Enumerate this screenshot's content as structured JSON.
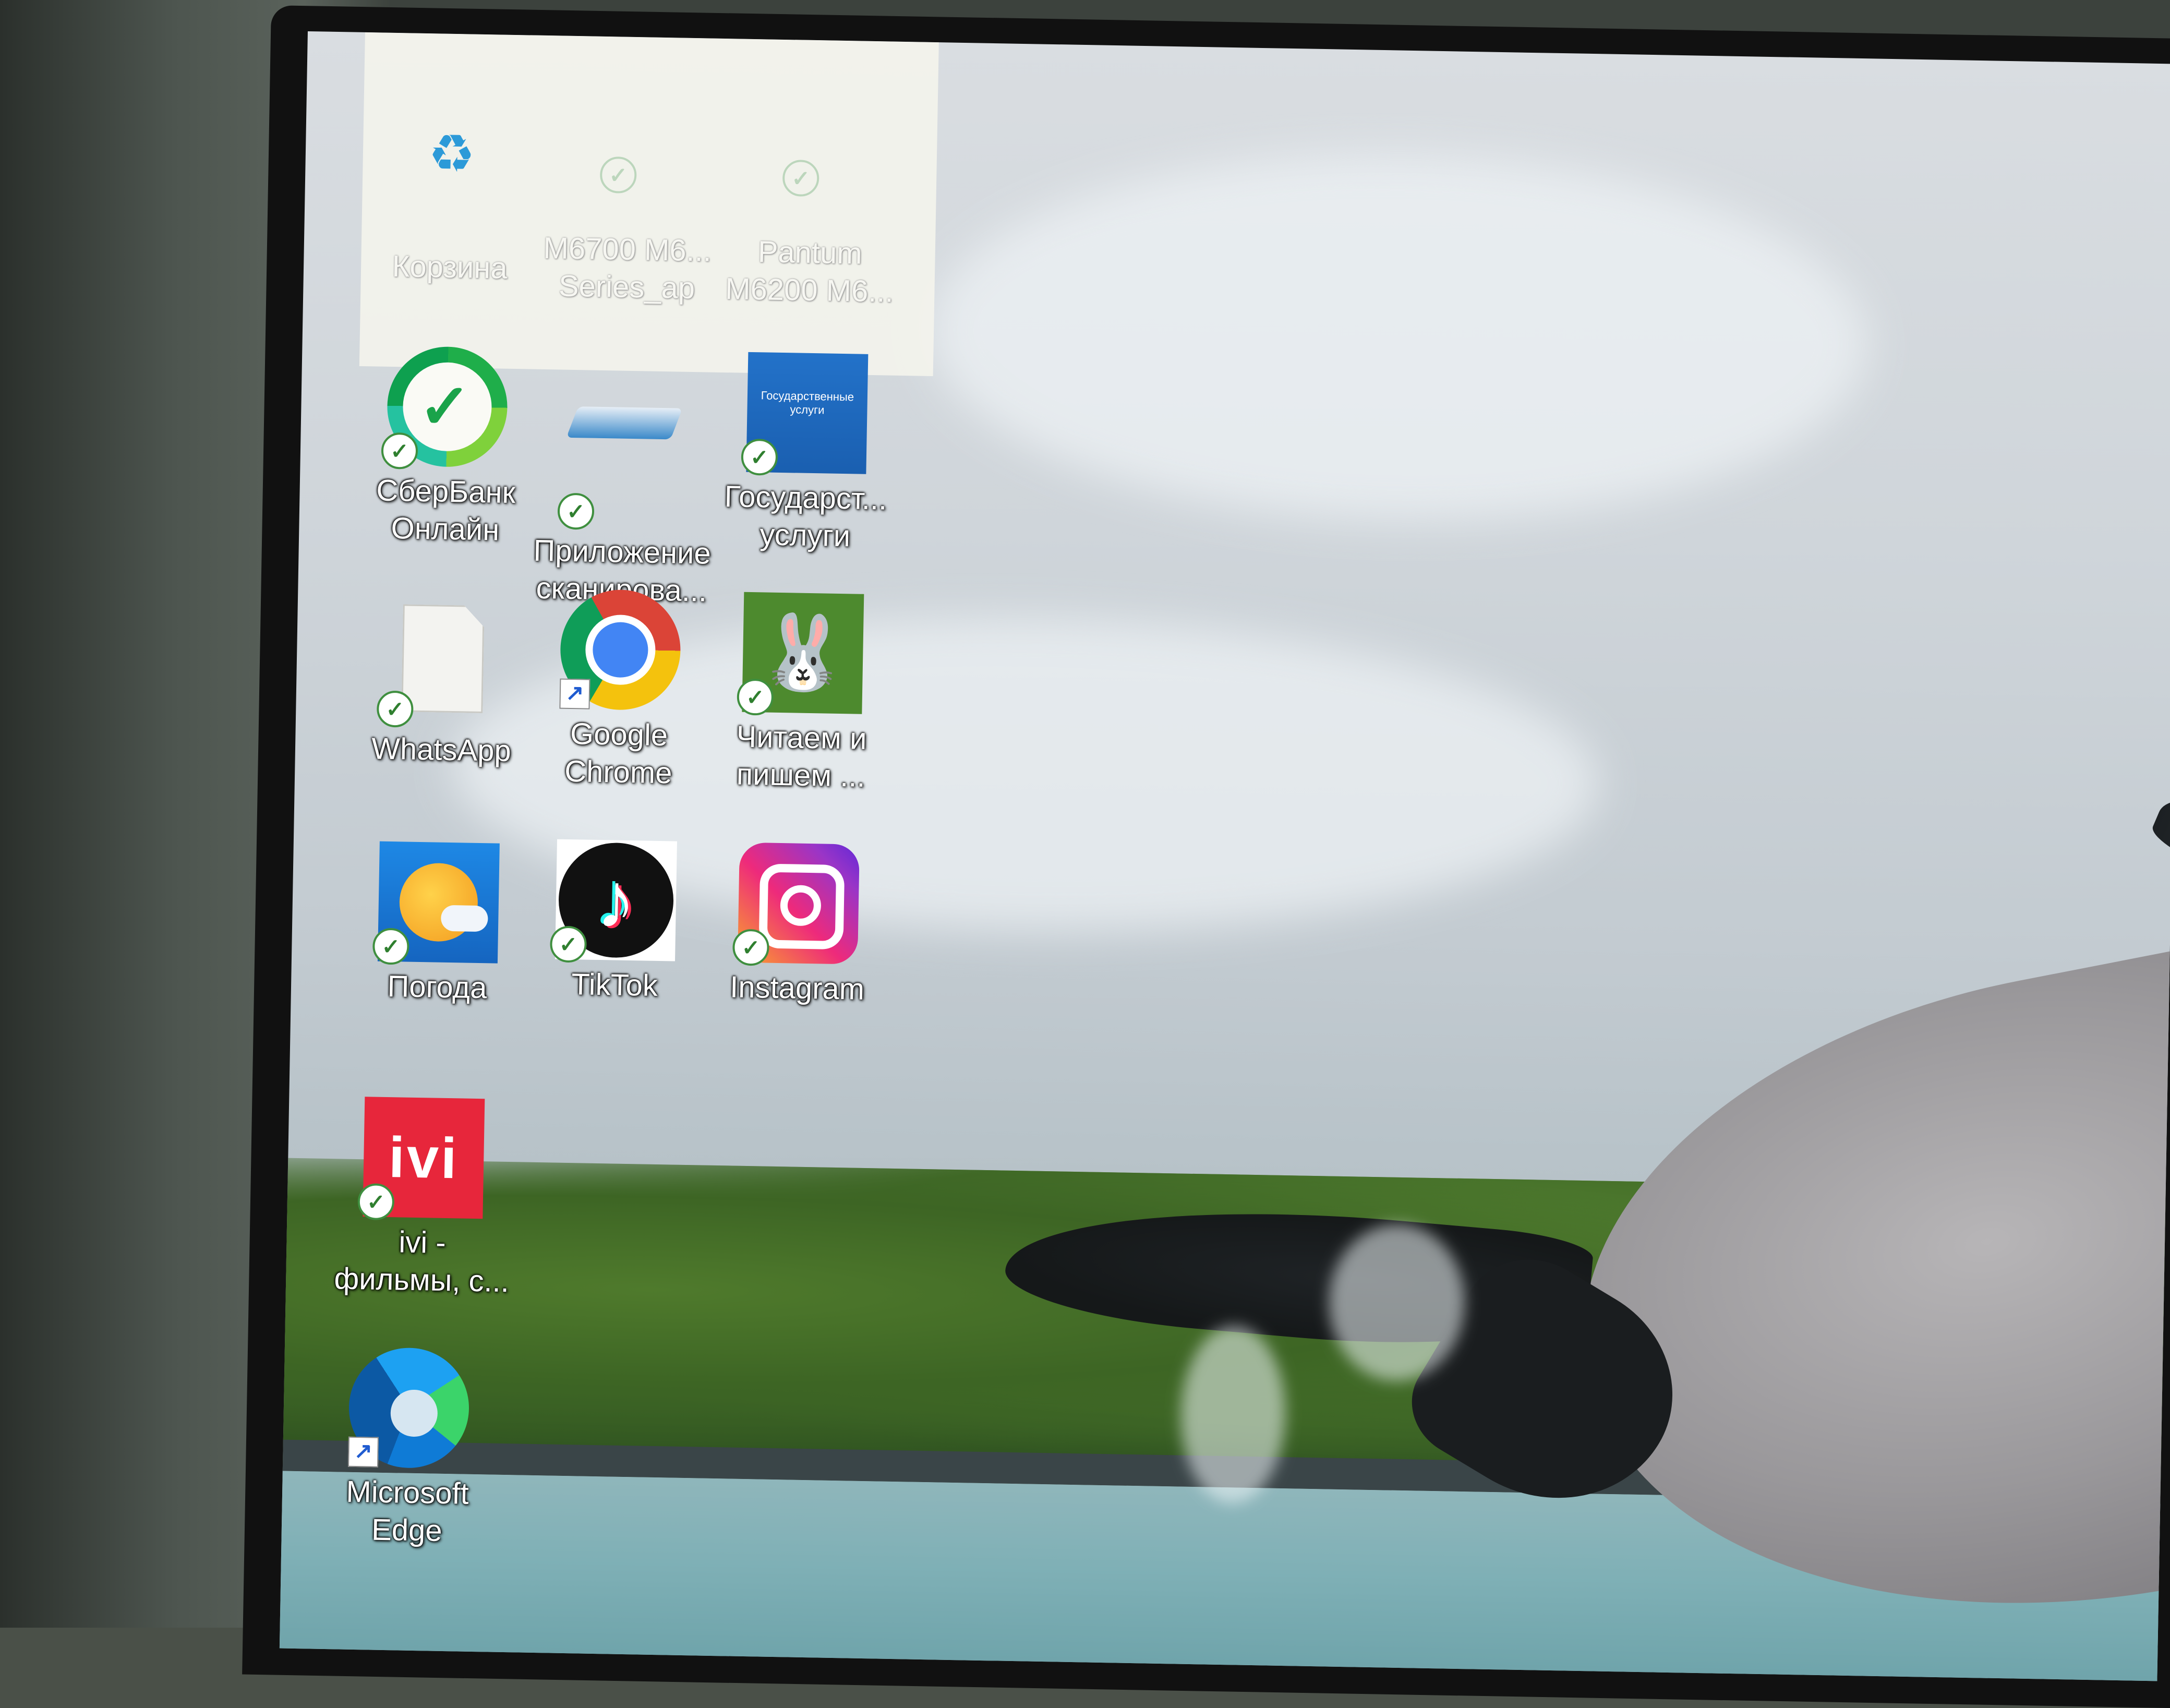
{
  "desktop": {
    "icons": [
      {
        "label": "Корзина",
        "icon": "recycle-bin-icon",
        "status": "none"
      },
      {
        "label": "M6700 M6...\nSeries_ap",
        "icon": "file-icon",
        "status": "synced"
      },
      {
        "label": "Pantum\nM6200 M6...",
        "icon": "file-icon",
        "status": "synced"
      },
      {
        "label": "СберБанк\nОнлайн",
        "icon": "sberbank-icon",
        "status": "synced"
      },
      {
        "label": "Приложение\nсканирова...",
        "icon": "scanner-icon",
        "status": "synced"
      },
      {
        "label": "Государст...\nуслуги",
        "icon": "gosuslugi-icon",
        "status": "synced"
      },
      {
        "label": "WhatsApp",
        "icon": "blank-document-icon",
        "status": "synced"
      },
      {
        "label": "Google\nChrome",
        "icon": "chrome-icon",
        "status": "shortcut"
      },
      {
        "label": "Читаем и\nпишем ...",
        "icon": "reading-app-icon",
        "status": "synced"
      },
      {
        "label": "Погода",
        "icon": "weather-icon",
        "status": "synced"
      },
      {
        "label": "TikTok",
        "icon": "tiktok-icon",
        "status": "synced"
      },
      {
        "label": "Instagram",
        "icon": "instagram-icon",
        "status": "synced"
      },
      {
        "label": "ivi -\nфильмы, с...",
        "icon": "ivi-icon",
        "status": "synced"
      },
      {
        "label": "Microsoft\nEdge",
        "icon": "edge-icon",
        "status": "shortcut"
      }
    ],
    "gosuslugi_logo_text": "Государственные\nуслуги",
    "ivi_logo_text": "ivi",
    "check_glyph": "✓",
    "shortcut_glyph": "↗"
  },
  "wallpaper": {
    "subject": "dolphin-jumping",
    "colors": {
      "sky": "#cfd5da",
      "trees": "#3f6a27",
      "water": "#7fb0b6"
    }
  }
}
